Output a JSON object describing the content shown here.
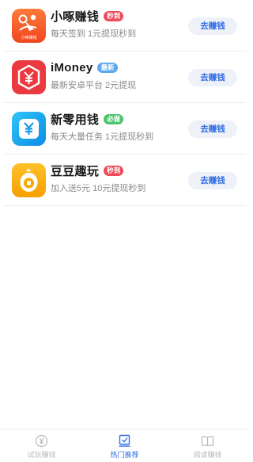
{
  "apps": [
    {
      "name": "小啄赚钱",
      "badge": "秒到",
      "badge_color": "#ef4a5a",
      "desc": "每天签到 1元提现秒到",
      "button": "去赚钱",
      "icon": "xiaozhuo-bird-icon",
      "icon_sub": "小啄赚钱"
    },
    {
      "name": "iMoney",
      "badge": "最新",
      "badge_color": "#5aa7f0",
      "desc": "最新安卓平台 2元提现",
      "button": "去赚钱",
      "icon": "imoney-yen-hexagon-icon",
      "icon_sub": ""
    },
    {
      "name": "新零用钱",
      "badge": "必做",
      "badge_color": "#4cc36b",
      "desc": "每天大量任务 1元提现秒到",
      "button": "去赚钱",
      "icon": "yen-wallet-icon",
      "icon_sub": ""
    },
    {
      "name": "豆豆趣玩",
      "badge": "秒到",
      "badge_color": "#ef4a5a",
      "desc": "加入送5元 10元提现秒到",
      "button": "去赚钱",
      "icon": "coin-bean-icon",
      "icon_sub": ""
    }
  ],
  "tabbar": {
    "tabs": [
      {
        "label": "试玩赚钱",
        "icon": "yen-circle-icon",
        "active": false
      },
      {
        "label": "热门推荐",
        "icon": "checkbox-tray-icon",
        "active": true
      },
      {
        "label": "阅读赚钱",
        "icon": "open-book-icon",
        "active": false
      }
    ]
  },
  "colors": {
    "accent": "#2f6ce5",
    "button_bg": "#eef1f7",
    "inactive": "#b8b8b8"
  }
}
